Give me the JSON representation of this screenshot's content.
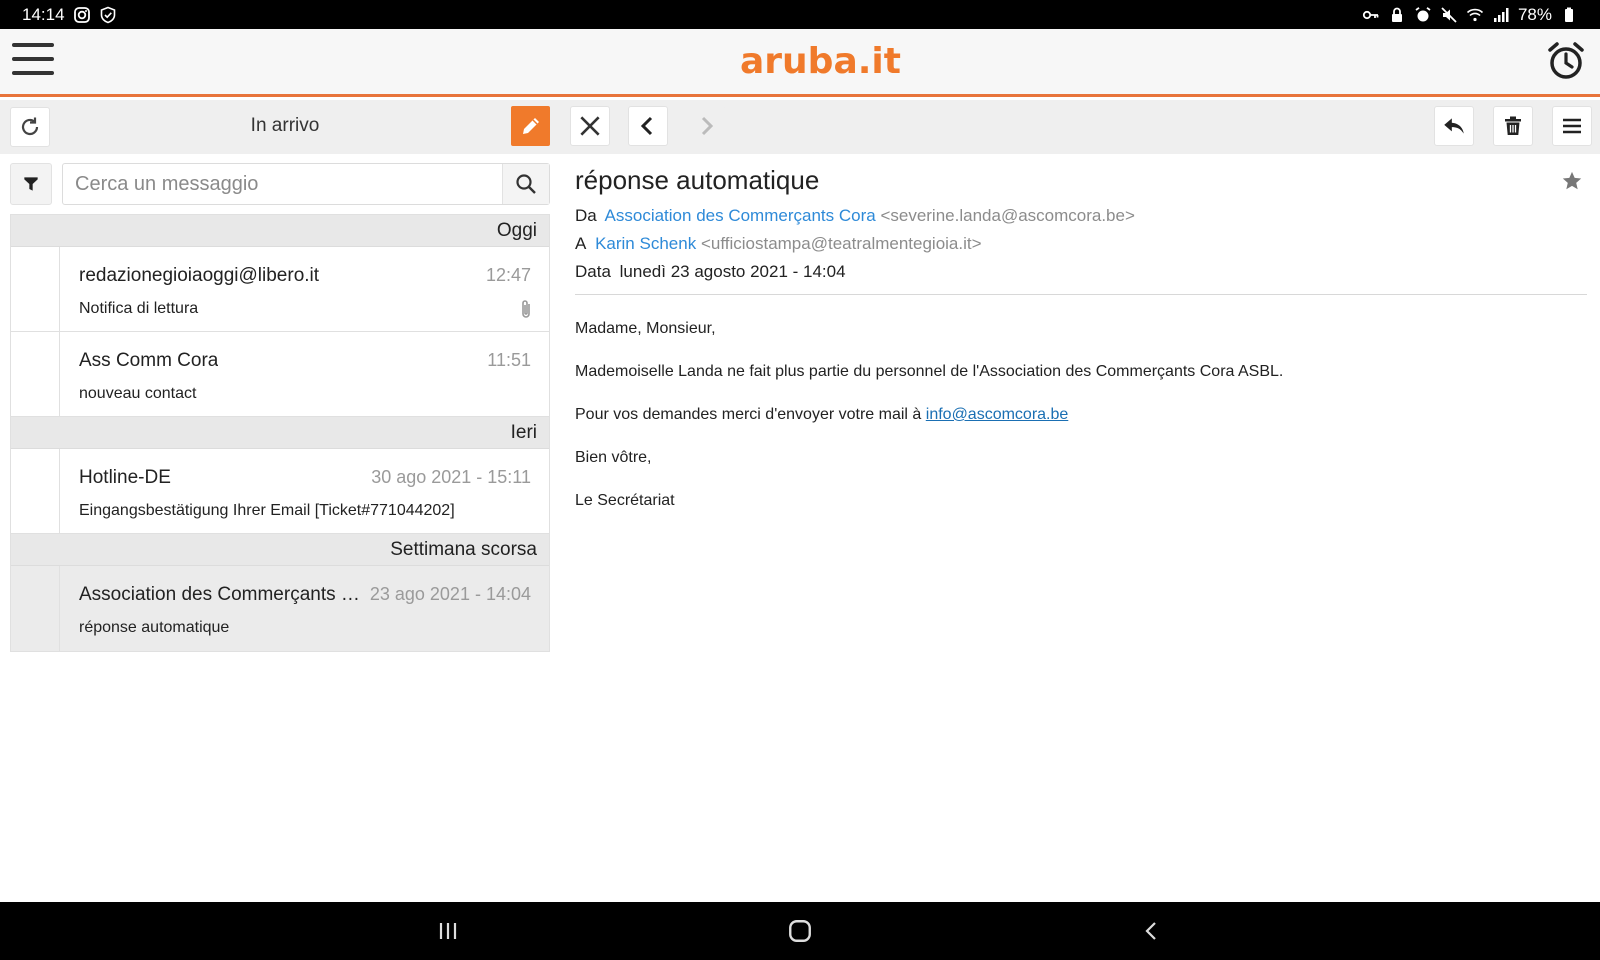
{
  "status_bar": {
    "time": "14:14",
    "battery": "78%",
    "icons": [
      "instagram-icon",
      "shield-icon",
      "key-icon",
      "lock-icon",
      "alarm-icon",
      "mute-icon",
      "wifi-icon",
      "signal-icon",
      "battery-icon"
    ]
  },
  "app": {
    "logo": "aruba.it",
    "accent_color": "#f07a2b",
    "link_color": "#2e8ad8"
  },
  "left_toolbar": {
    "folder_title": "In arrivo"
  },
  "search": {
    "placeholder": "Cerca un messaggio"
  },
  "groups": {
    "today": "Oggi",
    "yesterday": "Ieri",
    "last_week": "Settimana scorsa"
  },
  "messages": [
    {
      "sender": "redazionegioiaoggi@libero.it",
      "time": "12:47",
      "subject": "Notifica di lettura",
      "attachment": true
    },
    {
      "sender": "Ass Comm Cora",
      "time": "11:51",
      "subject": "nouveau contact",
      "attachment": false
    },
    {
      "sender": "Hotline-DE",
      "time": "30 ago 2021 - 15:11",
      "subject": "Eingangsbestätigung Ihrer Email [Ticket#771044202]",
      "attachment": false
    },
    {
      "sender": "Association des Commerçants Cora",
      "time": "23 ago 2021 - 14:04",
      "subject": "réponse automatique",
      "attachment": false,
      "selected": true
    }
  ],
  "mail": {
    "subject": "réponse automatique",
    "from_label": "Da",
    "from_name": "Association des Commerçants Cora",
    "from_addr": "<severine.landa@ascomcora.be>",
    "to_label": "A",
    "to_name": "Karin Schenk",
    "to_addr": "<ufficiostampa@teatralmentegioia.it>",
    "date_label": "Data",
    "date_value": "lunedì 23 agosto 2021 - 14:04",
    "body": {
      "p1": "Madame, Monsieur,",
      "p2": "Mademoiselle Landa ne fait plus partie du personnel de l'Association des Commerçants Cora ASBL.",
      "p3_prefix": "Pour vos demandes merci d'envoyer votre mail à ",
      "p3_link": "info@ascomcora.be",
      "p4": "Bien vôtre,",
      "p5": "Le Secrétariat"
    }
  }
}
